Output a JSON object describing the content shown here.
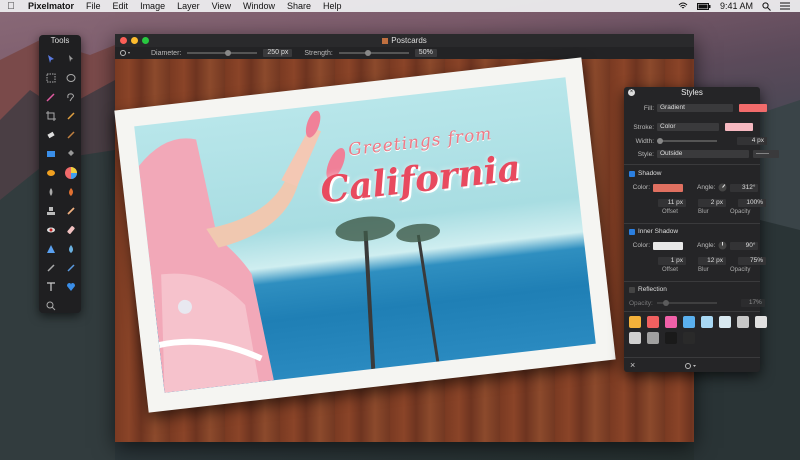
{
  "menubar": {
    "app_name": "Pixelmator",
    "items": [
      "File",
      "Edit",
      "Image",
      "Layer",
      "View",
      "Window",
      "Share",
      "Help"
    ],
    "time": "9:41 AM"
  },
  "tools_panel": {
    "title": "Tools"
  },
  "document": {
    "title": "Postcards",
    "diameter_label": "Diameter:",
    "diameter_value": "250 px",
    "strength_label": "Strength:",
    "strength_value": "50%",
    "greeting_line1": "Greetings from",
    "greeting_line2": "California"
  },
  "styles_panel": {
    "title": "Styles",
    "fill_label": "Fill:",
    "fill_value": "Gradient",
    "stroke_label": "Stroke:",
    "stroke_value": "Color",
    "width_label": "Width:",
    "width_value": "4 px",
    "style_label": "Style:",
    "style_value": "Outside",
    "shadow": {
      "label": "Shadow",
      "color_label": "Color:",
      "angle_label": "Angle:",
      "angle_value": "312°",
      "offset_value": "11 px",
      "blur_value": "2 px",
      "opacity_value": "100%",
      "offset_label": "Offset",
      "blur_label": "Blur",
      "opacity_label": "Opacity"
    },
    "inner_shadow": {
      "label": "Inner Shadow",
      "color_label": "Color:",
      "angle_label": "Angle:",
      "angle_value": "90°",
      "offset_value": "1 px",
      "blur_value": "12 px",
      "opacity_value": "75%",
      "offset_label": "Offset",
      "blur_label": "Blur",
      "opacity_label": "Opacity"
    },
    "reflection": {
      "label": "Reflection",
      "opacity_label": "Opacity:",
      "opacity_value": "17%"
    },
    "preset_colors": [
      "#f4b23a",
      "#f06060",
      "#f060a8",
      "#5ab0ee",
      "#a8d8f4",
      "#d8e8f0",
      "#c8c8c8",
      "#e0e0e0",
      "#d0d0d0",
      "#a0a0a0",
      "#1a1a1a",
      "#2a2a2a"
    ]
  },
  "colors": {
    "fill_swatch": "#f26b6b",
    "stroke_swatch": "#f6b8c0",
    "shadow_swatch": "#e07060",
    "inner_shadow_swatch": "#e8e8e8"
  }
}
